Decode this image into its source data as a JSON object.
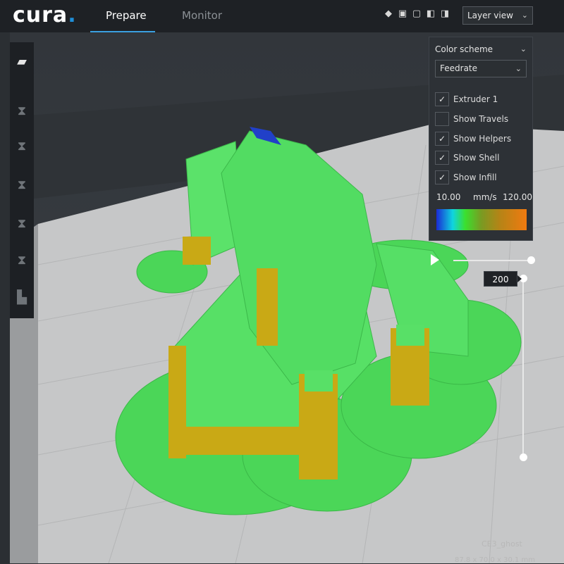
{
  "app": {
    "logo": "cura",
    "tabs": [
      {
        "label": "Prepare",
        "active": true
      },
      {
        "label": "Monitor",
        "active": false
      }
    ]
  },
  "toolbar": {
    "view_icons": [
      "cube-3d-icon",
      "cube-front-icon",
      "cube-top-icon",
      "cube-left-icon",
      "cube-right-icon"
    ],
    "view_select": "Layer view"
  },
  "left_tools": [
    "folder-icon",
    "move-icon",
    "scale-icon",
    "rotate-icon",
    "mirror-icon",
    "per-model-settings-icon",
    "support-blocker-icon"
  ],
  "layer_panel": {
    "color_scheme_label": "Color scheme",
    "scheme_value": "Feedrate",
    "options": [
      {
        "label": "Extruder 1",
        "checked": true
      },
      {
        "label": "Show Travels",
        "checked": false
      },
      {
        "label": "Show Helpers",
        "checked": true
      },
      {
        "label": "Show Shell",
        "checked": true
      },
      {
        "label": "Show Infill",
        "checked": true
      }
    ],
    "range_min": "10.00",
    "range_unit": "mm/s",
    "range_max": "120.00",
    "check_glyph": "✓"
  },
  "layer_slider": {
    "current_layer": "200"
  },
  "object": {
    "name": "CE3_ghost",
    "dimensions": "87.8 x 70.0 x 30.1 mm"
  },
  "colors": {
    "accent": "#3aa0e0",
    "model_green": "#4fdc5a",
    "support_yellow": "#c7a512"
  }
}
